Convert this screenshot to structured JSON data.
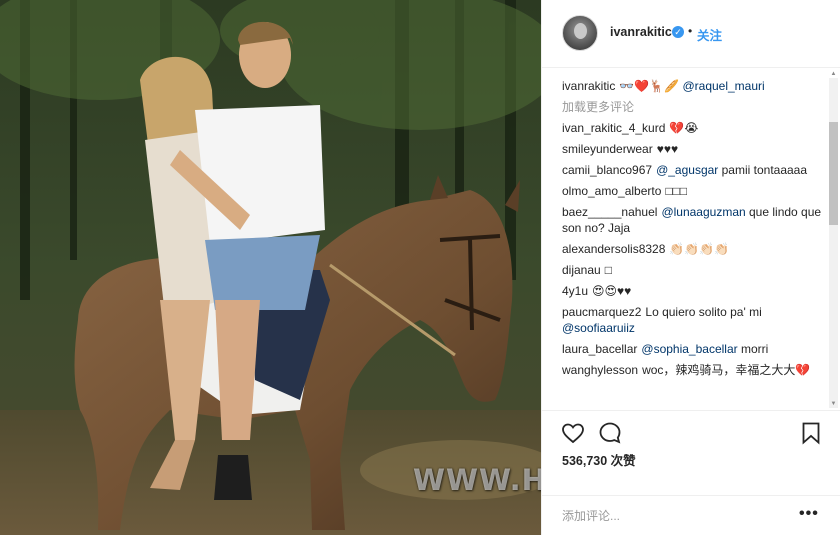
{
  "post": {
    "username": "ivanrakitic",
    "verified_mark": "✓",
    "separator": "•",
    "follow_label": "关注"
  },
  "caption": {
    "username": "ivanrakitic",
    "emoji": "👓❤️🦌🥖",
    "mention": "@raquel_mauri"
  },
  "load_more_label": "加载更多评论",
  "comments": [
    {
      "user": "ivan_rakitic_4_kurd",
      "pre": "",
      "mention": "",
      "text": "💔😭"
    },
    {
      "user": "smileyunderwear",
      "pre": "",
      "mention": "",
      "text": "♥♥♥"
    },
    {
      "user": "camii_blanco967",
      "pre": "",
      "mention": "@_agusgar",
      "text": " pamii tontaaaaa"
    },
    {
      "user": "olmo_amo_alberto",
      "pre": "",
      "mention": "",
      "text": "□□□"
    },
    {
      "user": "baez_____nahuel",
      "pre": "",
      "mention": "@lunaaguzman",
      "text": " que lindo que son no? Jaja"
    },
    {
      "user": "alexandersolis8328",
      "pre": "",
      "mention": "",
      "text": "👏🏻👏🏻👏🏻👏🏻"
    },
    {
      "user": "dijanau",
      "pre": "",
      "mention": "",
      "text": "□"
    },
    {
      "user": "4y1u",
      "pre": "",
      "mention": "",
      "text": "😍😍♥♥"
    },
    {
      "user": "paucmarquez2",
      "pre": "Lo quiero solito pa' mi ",
      "mention": "@soofiaaruiiz",
      "text": ""
    },
    {
      "user": "laura_bacellar",
      "pre": "",
      "mention": "@sophia_bacellar",
      "text": " morri"
    },
    {
      "user": "wanghylesson",
      "pre": "woc，辣鸡骑马，幸福之大大",
      "mention": "",
      "text": "💔"
    }
  ],
  "actions": {
    "like_icon": "heart-icon",
    "comment_icon": "comment-bubble-icon",
    "save_icon": "bookmark-icon",
    "likes_text": "536,730 次赞"
  },
  "add_comment": {
    "placeholder": "添加评论...",
    "more_label": "•••"
  },
  "watermark": "WWW.HORSE.ORG.CN",
  "colors": {
    "accent": "#3897f0",
    "mention": "#003569",
    "muted": "#999999",
    "text": "#262626"
  }
}
